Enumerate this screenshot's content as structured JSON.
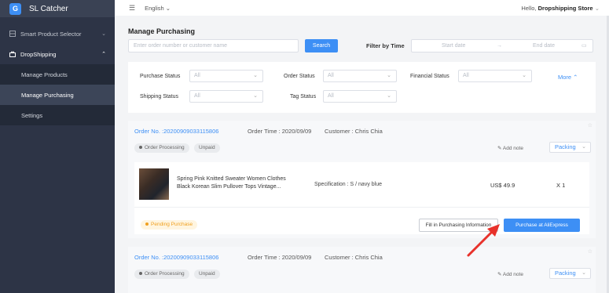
{
  "app": {
    "logo_glyph": "G",
    "name": "SL Catcher"
  },
  "sidebar": {
    "items": [
      {
        "label": "Smart Product Selector",
        "icon": "grid-icon",
        "chevron": "⌄"
      },
      {
        "label": "DropShipping",
        "icon": "bag-icon",
        "chevron": "⌃"
      }
    ],
    "subitems": [
      {
        "label": "Manage Products"
      },
      {
        "label": "Manage Purchasing"
      },
      {
        "label": "Settings"
      }
    ]
  },
  "topbar": {
    "menu_glyph": "☰",
    "language": "English ⌄",
    "greeting_prefix": "Hello, ",
    "store_name": "Dropshipping Store",
    "greeting_chevron": "⌄"
  },
  "page": {
    "title": "Manage Purchasing",
    "search": {
      "placeholder": "Enter order number or customer name",
      "button": "Search"
    },
    "filter_time": {
      "label": "Filter by Time",
      "start": "Start date",
      "arrow": "→",
      "end": "End date",
      "icon": "calendar-icon",
      "icon_glyph": "▭"
    },
    "filters": [
      {
        "label": "Purchase Status",
        "value": "All"
      },
      {
        "label": "Order Status",
        "value": "All"
      },
      {
        "label": "Financial Status",
        "value": "All"
      },
      {
        "label": "Shipping Status",
        "value": "All"
      },
      {
        "label": "Tag Status",
        "value": "All"
      }
    ],
    "select_arrow": "⌄",
    "more": "More ⌃"
  },
  "orders": [
    {
      "order_no": "Order No. :20200909033115806",
      "order_time": "Order Time : 2020/09/09",
      "customer": "Customer : Chris Chia",
      "tags": [
        "Order Processing",
        "Unpaid"
      ],
      "add_note": "Add note",
      "note_glyph": "✎",
      "packing": "Packing",
      "star_glyph": "☆",
      "item": {
        "name_line1": "Spring Pink Knitted Sweater Women Clothes",
        "name_line2": "Black Korean Slim Pullover Tops Vintage...",
        "spec": "Specification : S / navy blue",
        "price": "US$ 49.9",
        "qty": "X 1"
      },
      "purchase_tag": "Pending Purchase",
      "fill_button": "Fill in Purchasing Information",
      "aliexpress_button": "Purchase at AliExpress"
    },
    {
      "order_no": "Order No. :20200909033115806",
      "order_time": "Order Time : 2020/09/09",
      "customer": "Customer : Chris Chia",
      "tags": [
        "Order Processing",
        "Unpaid"
      ],
      "add_note": "Add note",
      "note_glyph": "✎",
      "packing": "Packing",
      "star_glyph": "☆"
    }
  ],
  "colors": {
    "accent": "#3d8ff5",
    "sidebar_bg": "#2d3446",
    "pending": "#f0a020",
    "arrow": "#e8322b"
  }
}
